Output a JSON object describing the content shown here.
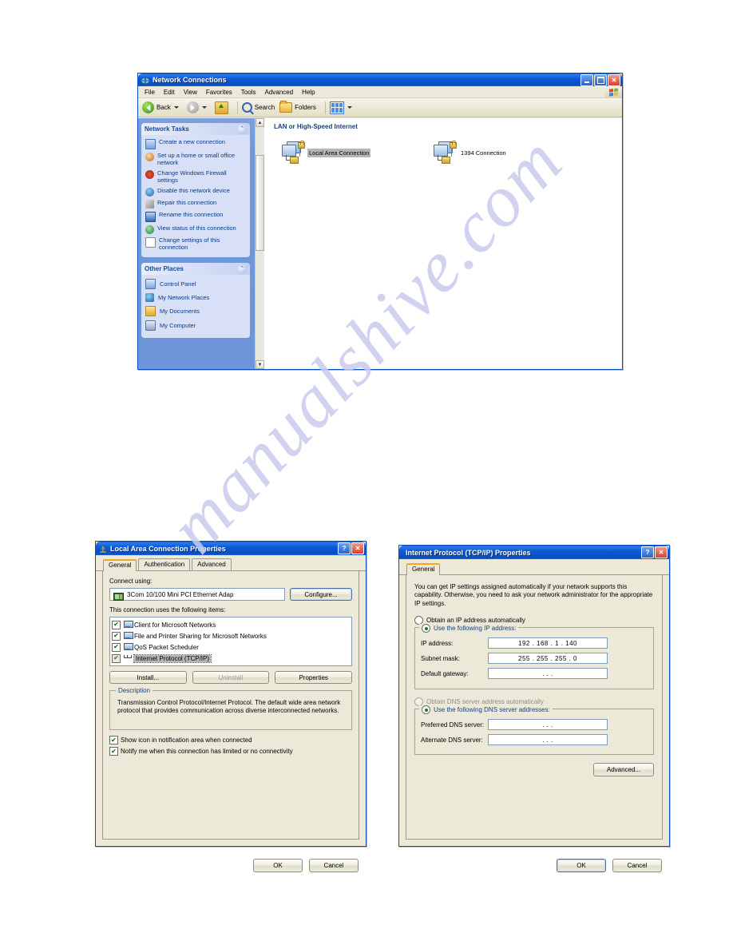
{
  "page": {
    "watermark": "manualshive.com"
  },
  "explorer": {
    "title": "Network Connections",
    "title_icon": "network-connections-icon",
    "window_buttons": {
      "minimize": "minimize-button",
      "maximize": "maximize-button",
      "close": "close-button"
    },
    "menu": [
      "File",
      "Edit",
      "View",
      "Favorites",
      "Tools",
      "Advanced",
      "Help"
    ],
    "toolbar": {
      "back": "Back",
      "forward": "",
      "up": "",
      "search": "Search",
      "folders": "Folders",
      "views": ""
    },
    "sidebar": {
      "panels": [
        {
          "title": "Network Tasks",
          "collapse_icon": "chevron-up-icon",
          "items": [
            {
              "label": "Create a new connection",
              "icon": "new-connection-icon"
            },
            {
              "label": "Set up a home or small office network",
              "icon": "home-network-icon"
            },
            {
              "label": "Change Windows Firewall settings",
              "icon": "firewall-icon"
            },
            {
              "label": "Disable this network device",
              "icon": "disable-device-icon"
            },
            {
              "label": "Repair this connection",
              "icon": "repair-icon"
            },
            {
              "label": "Rename this connection",
              "icon": "rename-icon"
            },
            {
              "label": "View status of this connection",
              "icon": "status-icon"
            },
            {
              "label": "Change settings of this connection",
              "icon": "settings-icon"
            }
          ]
        },
        {
          "title": "Other Places",
          "collapse_icon": "chevron-up-icon",
          "items": [
            {
              "label": "Control Panel",
              "icon": "control-panel-icon"
            },
            {
              "label": "My Network Places",
              "icon": "network-places-icon"
            },
            {
              "label": "My Documents",
              "icon": "my-documents-icon"
            },
            {
              "label": "My Computer",
              "icon": "my-computer-icon"
            }
          ]
        }
      ]
    },
    "content": {
      "group_header": "LAN or High-Speed Internet",
      "connections": [
        {
          "label": "Local Area Connection",
          "selected": true
        },
        {
          "label": "1394 Connection",
          "selected": false
        }
      ]
    }
  },
  "lan_dialog": {
    "title": "Local Area Connection Properties",
    "title_icon": "network-adapter-icon",
    "help_button": "?",
    "close_button": "close-button",
    "tabs": [
      {
        "label": "General",
        "active": true
      },
      {
        "label": "Authentication",
        "active": false
      },
      {
        "label": "Advanced",
        "active": false
      }
    ],
    "connect_using_label": "Connect using:",
    "adapter": "3Com 10/100 Mini PCI Ethernet Adap",
    "configure_button": "Configure...",
    "items_label": "This connection uses the following items:",
    "items": [
      {
        "label": "Client for Microsoft Networks",
        "checked": true,
        "selected": false,
        "icon": "client-network-icon"
      },
      {
        "label": "File and Printer Sharing for Microsoft Networks",
        "checked": true,
        "selected": false,
        "icon": "file-sharing-icon"
      },
      {
        "label": "QoS Packet Scheduler",
        "checked": true,
        "selected": false,
        "icon": "qos-icon"
      },
      {
        "label": "Internet Protocol (TCP/IP)",
        "checked": true,
        "selected": true,
        "icon": "tcpip-icon"
      }
    ],
    "install_button": "Install...",
    "uninstall_button": "Uninstall",
    "properties_button": "Properties",
    "description_legend": "Description",
    "description_text": "Transmission Control Protocol/Internet Protocol. The default wide area network protocol that provides communication across diverse interconnected networks.",
    "checkbox_show_icon": {
      "label": "Show icon in notification area when connected",
      "checked": true
    },
    "checkbox_notify": {
      "label": "Notify me when this connection has limited or no connectivity",
      "checked": true
    },
    "ok_button": "OK",
    "cancel_button": "Cancel"
  },
  "tcpip_dialog": {
    "title": "Internet Protocol (TCP/IP) Properties",
    "help_button": "?",
    "close_button": "close-button",
    "tabs": [
      {
        "label": "General",
        "active": true
      }
    ],
    "intro_text": "You can get IP settings assigned automatically if your network supports this capability. Otherwise, you need to ask your network administrator for the appropriate IP settings.",
    "ip_auto_radio": {
      "label": "Obtain an IP address automatically",
      "selected": false
    },
    "ip_manual_radio": {
      "label": "Use the following IP address:",
      "selected": true
    },
    "ip_fields": [
      {
        "label": "IP address:",
        "value": "192 . 168 .   1  . 140"
      },
      {
        "label": "Subnet mask:",
        "value": "255 . 255 . 255 .   0"
      },
      {
        "label": "Default gateway:",
        "value": " .     .     . "
      }
    ],
    "dns_auto_radio": {
      "label": "Obtain DNS server address automatically",
      "selected": false,
      "disabled": true
    },
    "dns_manual_radio": {
      "label": "Use the following DNS server addresses:",
      "selected": true
    },
    "dns_fields": [
      {
        "label": "Preferred DNS server:",
        "value": " .     .     . "
      },
      {
        "label": "Alternate DNS server:",
        "value": " .     .     . "
      }
    ],
    "advanced_button": "Advanced...",
    "ok_button": "OK",
    "cancel_button": "Cancel"
  }
}
